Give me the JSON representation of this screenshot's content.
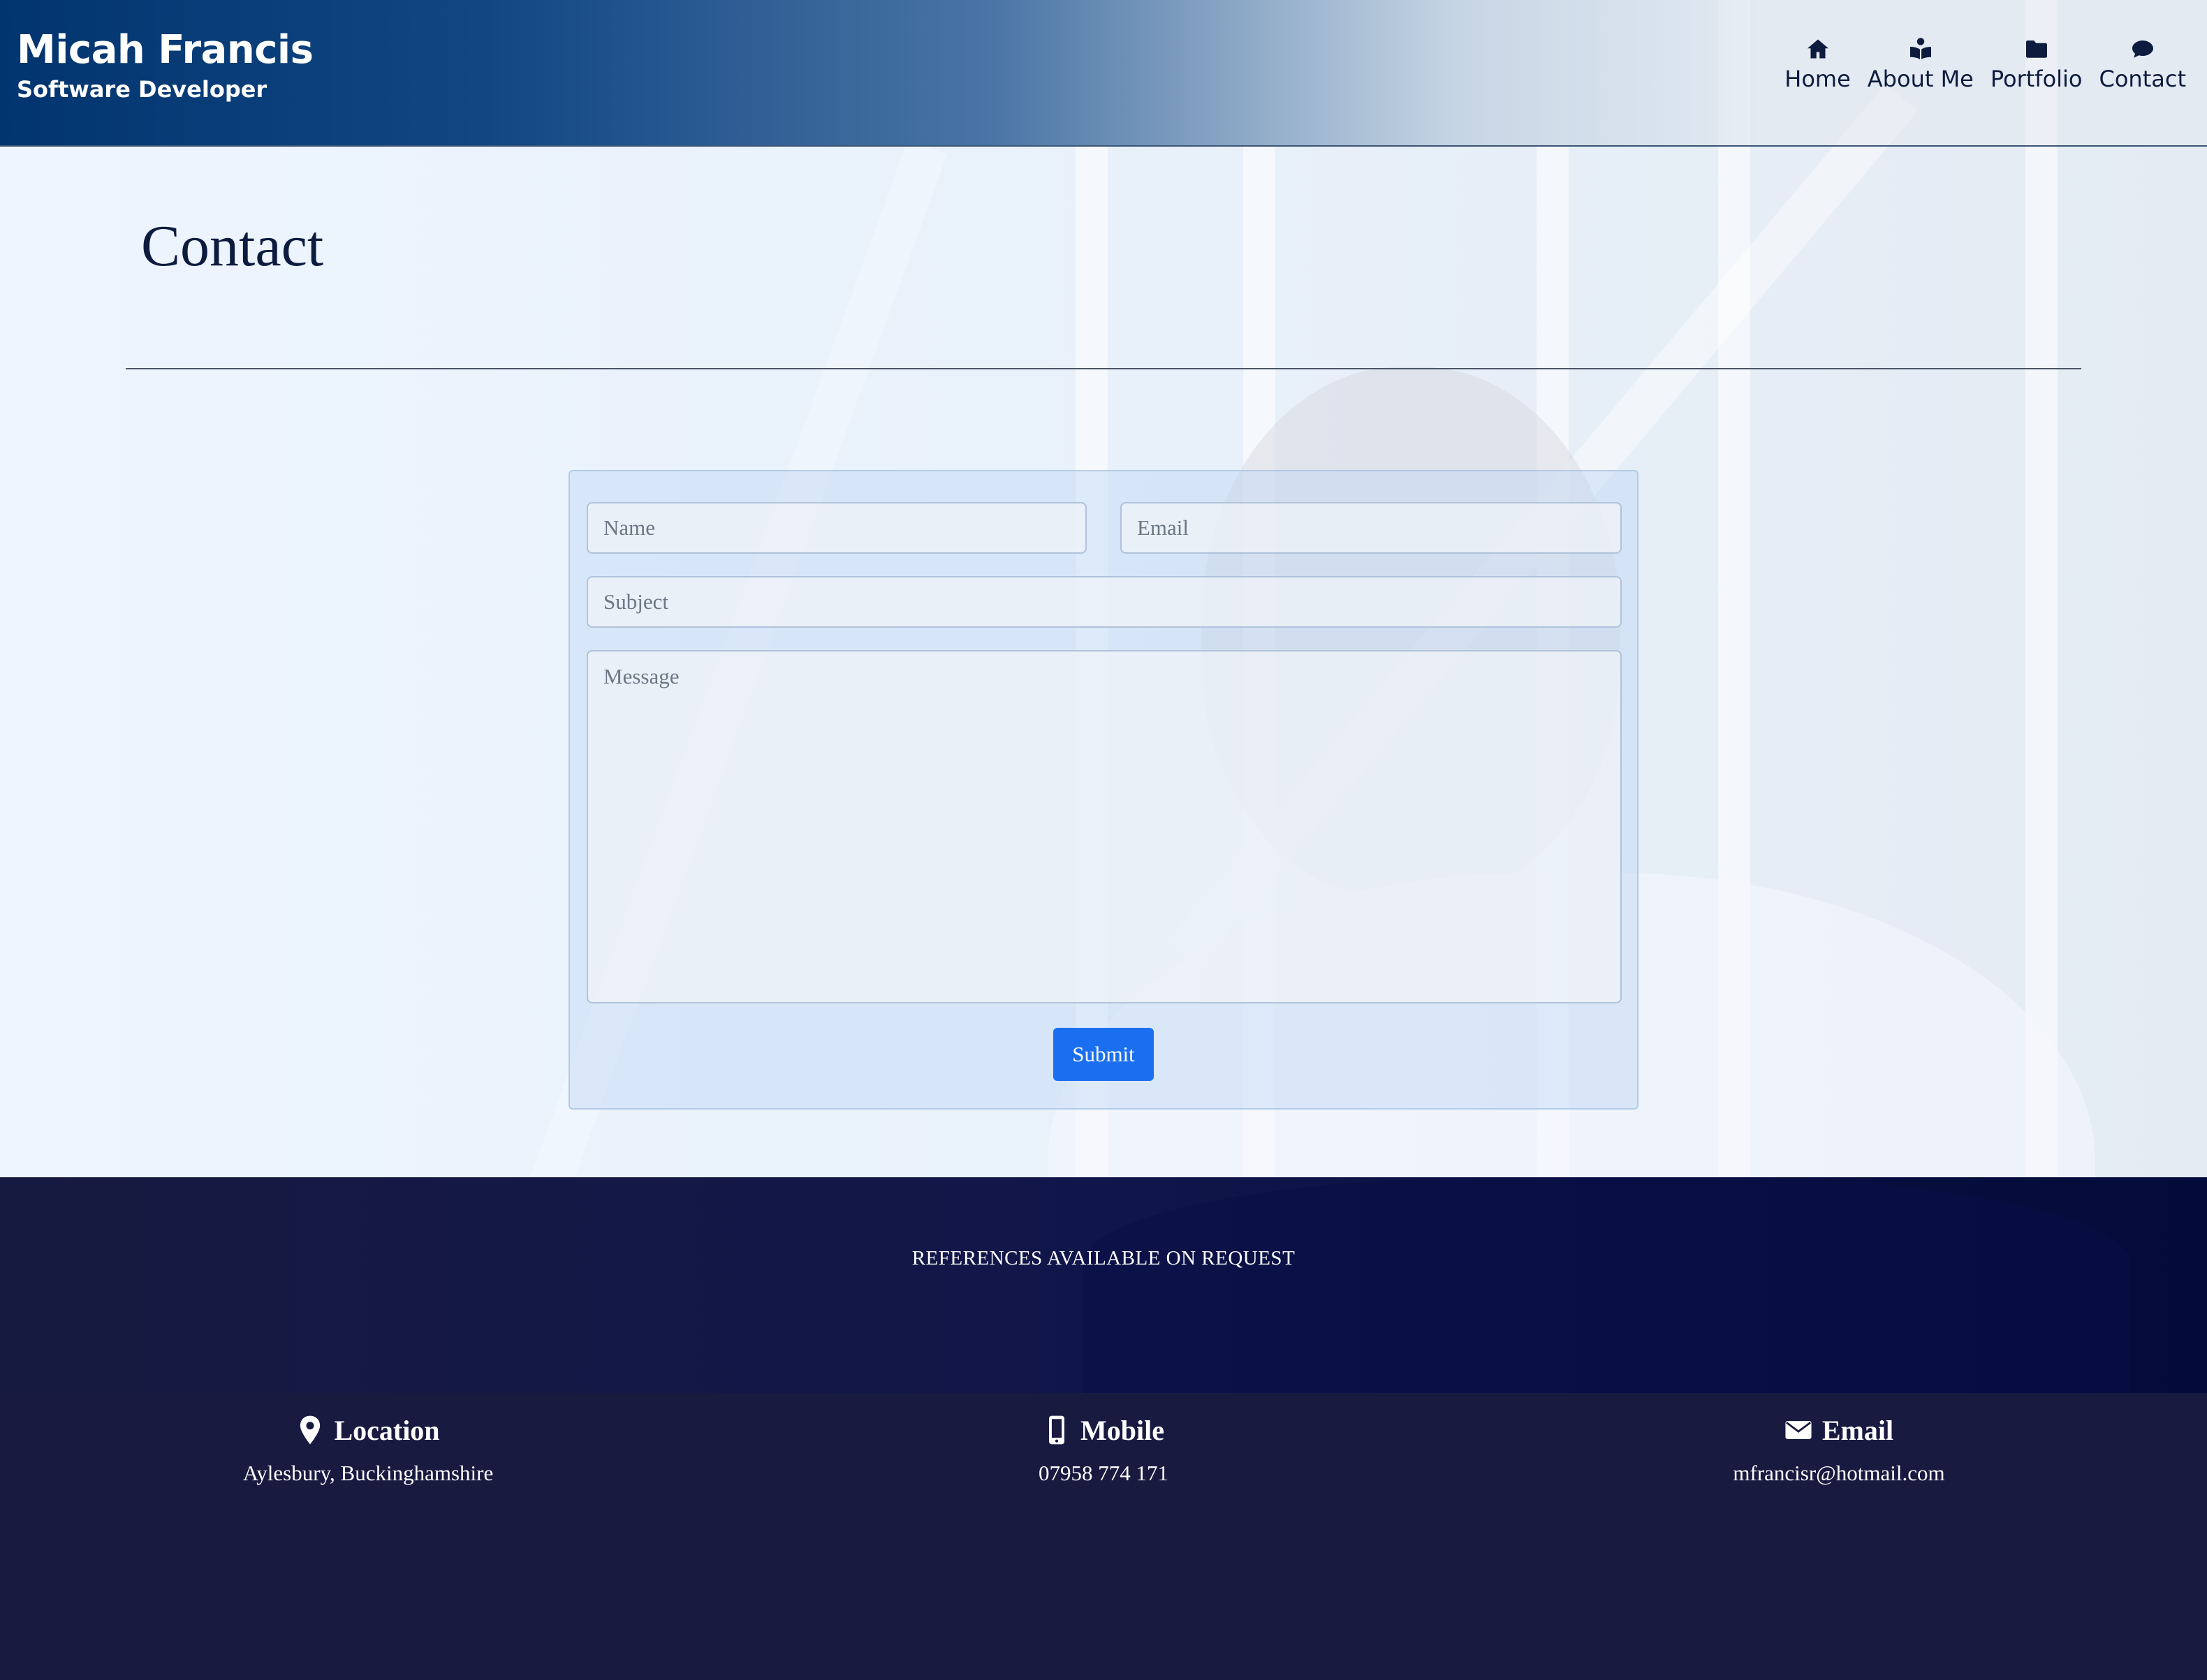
{
  "header": {
    "name": "Micah Francis",
    "subtitle": "Software Developer",
    "nav": [
      {
        "label": "Home",
        "icon": "home-icon"
      },
      {
        "label": "About Me",
        "icon": "reader-icon"
      },
      {
        "label": "Portfolio",
        "icon": "folder-icon"
      },
      {
        "label": "Contact",
        "icon": "chat-icon"
      }
    ]
  },
  "page": {
    "title": "Contact"
  },
  "form": {
    "name_placeholder": "Name",
    "email_placeholder": "Email",
    "subject_placeholder": "Subject",
    "message_placeholder": "Message",
    "submit_label": "Submit"
  },
  "references": "REFERENCES AVAILABLE ON REQUEST",
  "footer": {
    "location": {
      "heading": "Location",
      "value": "Aylesbury, Buckinghamshire",
      "icon": "map-pin-icon"
    },
    "mobile": {
      "heading": "Mobile",
      "value": "07958 774 171",
      "icon": "mobile-phone-icon"
    },
    "email": {
      "heading": "Email",
      "value": "mfrancisr@hotmail.com",
      "icon": "envelope-icon"
    }
  },
  "colors": {
    "header_dark": "#02356f",
    "text_dark": "#0d1b3e",
    "submit_blue": "#1a6ff0",
    "footer_bg": "#181a40"
  }
}
